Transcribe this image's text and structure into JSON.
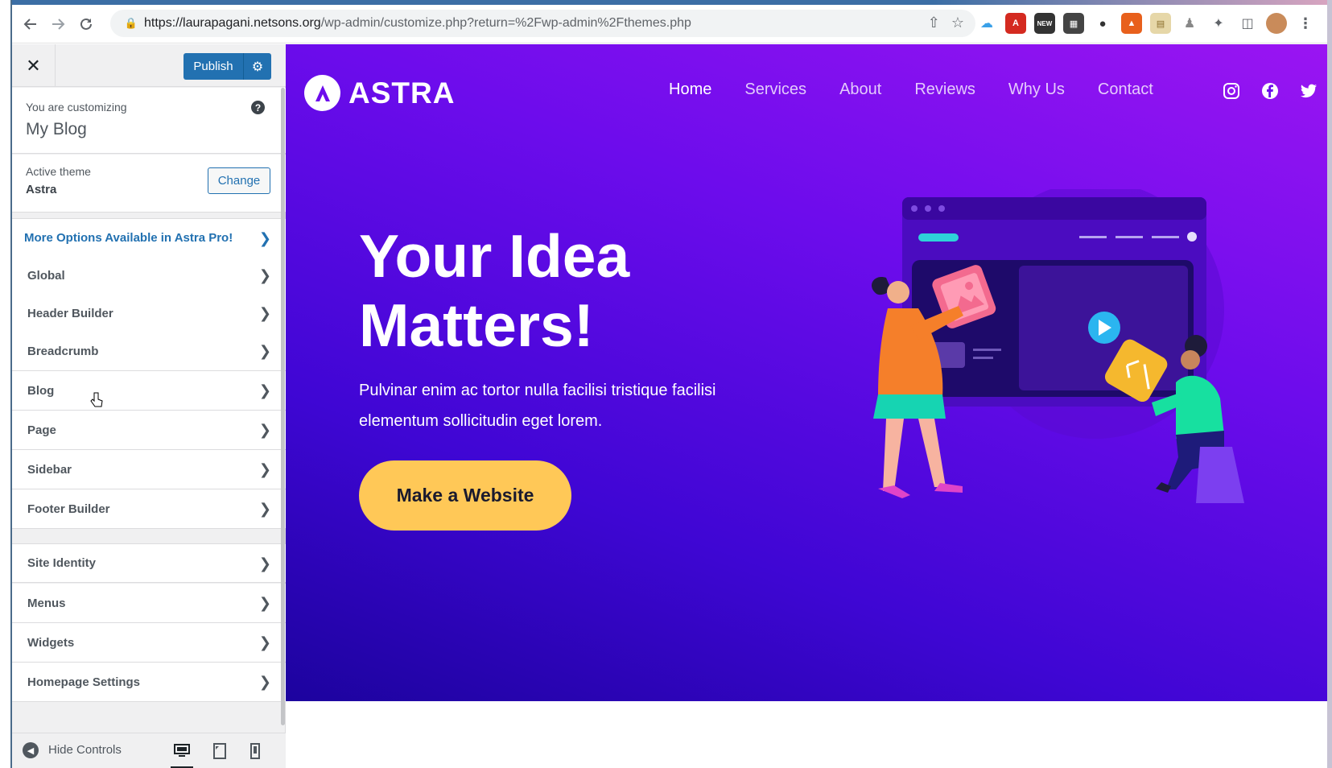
{
  "browser": {
    "url_host": "https://laurapagani.netsons.org",
    "url_path": "/wp-admin/customize.php?return=%2Fwp-admin%2Fthemes.php"
  },
  "sidebar": {
    "publish_label": "Publish",
    "customizing_label": "You are customizing",
    "site_title": "My Blog",
    "active_theme_label": "Active theme",
    "active_theme_name": "Astra",
    "change_label": "Change",
    "pro_label": "More Options Available in Astra Pro!",
    "group1": [
      {
        "label": "Global"
      },
      {
        "label": "Header Builder"
      },
      {
        "label": "Breadcrumb"
      },
      {
        "label": "Blog"
      },
      {
        "label": "Page"
      },
      {
        "label": "Sidebar"
      },
      {
        "label": "Footer Builder"
      }
    ],
    "group2": [
      {
        "label": "Site Identity"
      },
      {
        "label": "Menus"
      },
      {
        "label": "Widgets"
      },
      {
        "label": "Homepage Settings"
      }
    ],
    "hide_controls_label": "Hide Controls"
  },
  "preview": {
    "logo_text": "ASTRA",
    "nav": [
      "Home",
      "Services",
      "About",
      "Reviews",
      "Why Us",
      "Contact"
    ],
    "hero_title": "Your Idea Matters!",
    "hero_subtitle": "Pulvinar enim ac tortor nulla facilisi tristique facilisi elementum sollicitudin eget lorem.",
    "cta_label": "Make a Website"
  },
  "colors": {
    "wp_blue": "#2271b1",
    "hero_purple": "#6d0cec",
    "cta_yellow": "#ffc857"
  }
}
